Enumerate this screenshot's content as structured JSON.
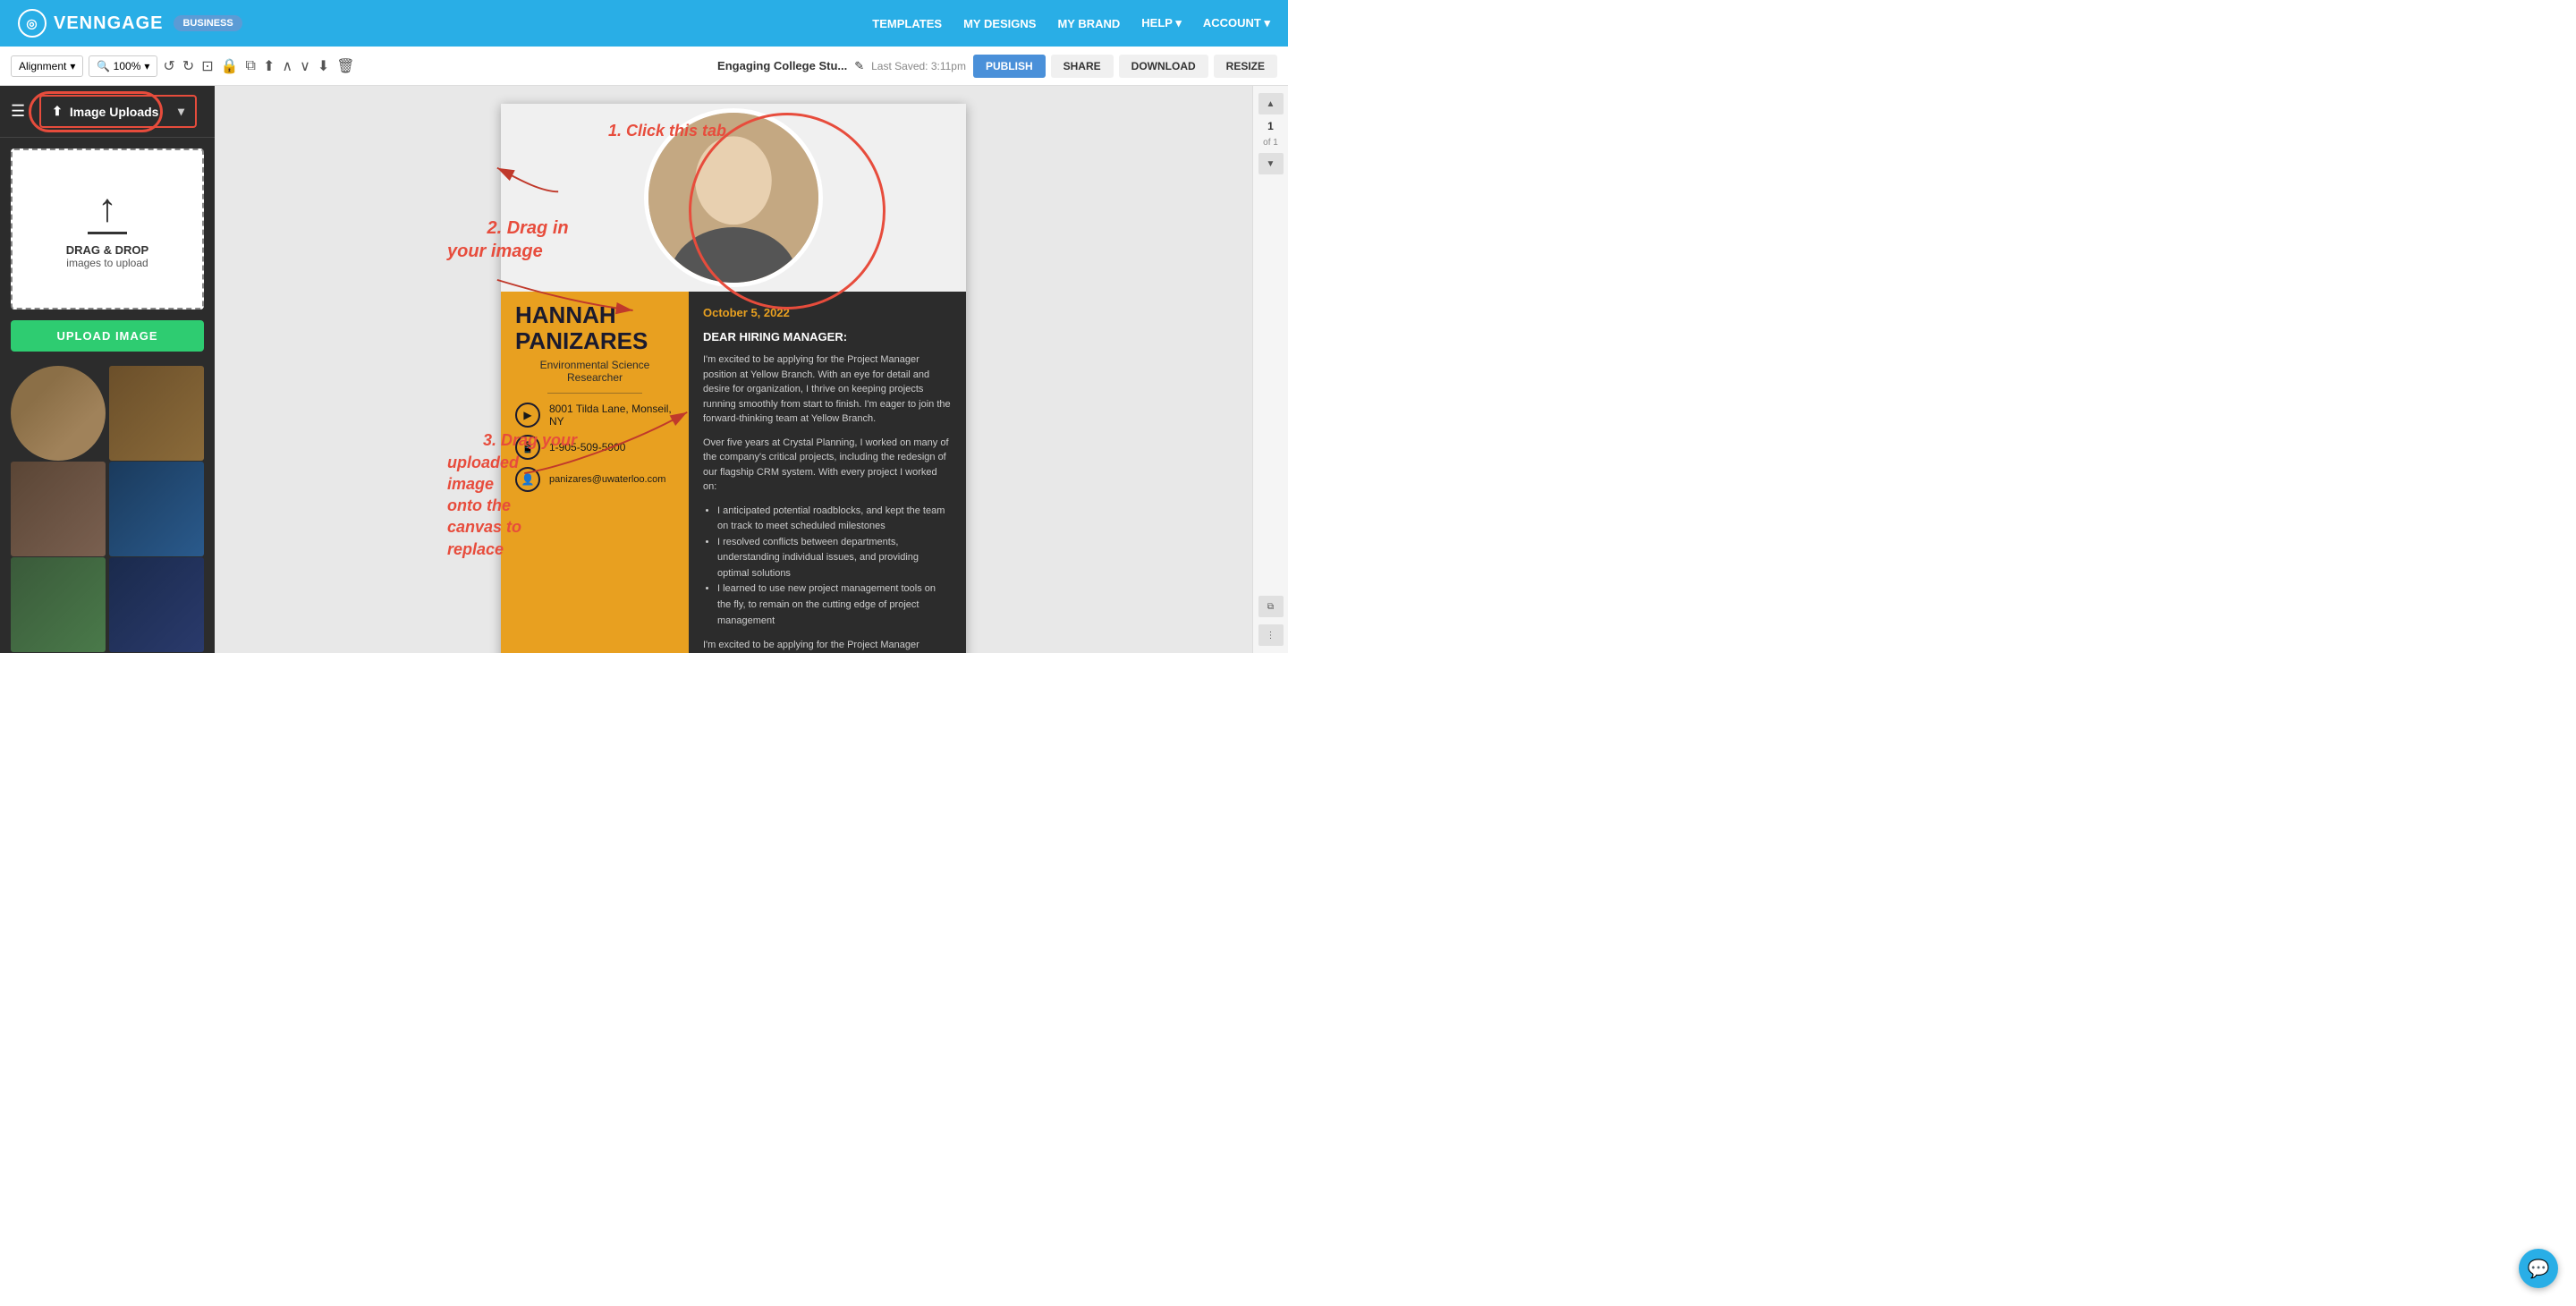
{
  "topnav": {
    "logo_text": "VENNGAGE",
    "business_badge": "BUSINESS",
    "nav_items": [
      "TEMPLATES",
      "MY DESIGNS",
      "MY BRAND",
      "HELP ▾",
      "ACCOUNT ▾"
    ]
  },
  "toolbar": {
    "alignment_label": "Alignment",
    "zoom_label": "🔍 100%",
    "doc_title": "Engaging College Stu...",
    "last_saved": "Last Saved: 3:11pm",
    "publish_btn": "PUBLISH",
    "share_btn": "SHARE",
    "download_btn": "DOWNLOAD",
    "resize_btn": "RESIZE"
  },
  "sidebar": {
    "image_uploads_label": "Image Uploads",
    "drag_drop_main": "DRAG & DROP",
    "drag_drop_sub": "images to upload",
    "upload_btn_label": "UPLOAD IMAGE"
  },
  "canvas": {
    "date": "October 5, 2022",
    "greeting": "DEAR HIRING MANAGER:",
    "person_name_line1": "HANNAH",
    "person_name_line2": "PANIZARES",
    "person_title": "Environmental Science Researcher",
    "address": "8001 Tilda Lane, Monseil, NY",
    "phone": "1-905-509-5900",
    "email": "panizares@uwaterloo.com",
    "body1": "I'm excited to be applying for the Project Manager position at Yellow Branch. With an eye for detail and desire for organization, I thrive on keeping projects running smoothly from start to finish. I'm eager to join the forward-thinking team at Yellow Branch.",
    "body2": "Over five years at Crystal Planning, I worked on many of the company's critical projects, including the redesign of our flagship CRM system. With every project I worked on:",
    "bullet1": "I anticipated potential roadblocks, and kept the team on track to meet scheduled milestones",
    "bullet2": "I resolved conflicts between departments, understanding individual issues, and providing optimal solutions",
    "bullet3": "I learned to use new project management tools on the fly, to remain on the cutting edge of project management",
    "body3": "I'm excited to be applying for the Project Manager position at Yellow Branch. With an eye for detail and desire for organization, I thrive on keeping projects running smoothly from start to finish. I'm eager to join"
  },
  "annotations": {
    "step1": "1. Click this tab",
    "step2": "2. Drag in\nyour image",
    "step3": "3. Drag your\nuploaded\nimage\nonto the\ncanvas to\nreplace"
  },
  "pagination": {
    "current": "1",
    "total": "of 1"
  }
}
